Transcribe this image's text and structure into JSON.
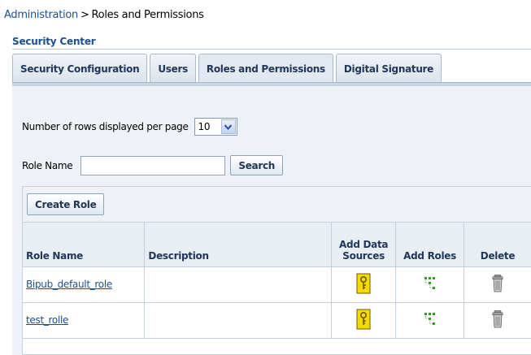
{
  "breadcrumb": {
    "parent": "Administration",
    "separator": ">",
    "current": "Roles and Permissions"
  },
  "section_title": "Security Center",
  "tabs": [
    {
      "label": "Security Configuration",
      "active": false
    },
    {
      "label": "Users",
      "active": false
    },
    {
      "label": "Roles and Permissions",
      "active": true
    },
    {
      "label": "Digital Signature",
      "active": false
    }
  ],
  "rows_per_page": {
    "label": "Number of rows displayed per page",
    "value": "10"
  },
  "search": {
    "label": "Role Name",
    "value": "",
    "button": "Search"
  },
  "create_button": "Create Role",
  "table": {
    "headers": {
      "role_name": "Role Name",
      "description": "Description",
      "add_data_sources_1": "Add Data",
      "add_data_sources_2": "Sources",
      "add_roles": "Add Roles",
      "delete": "Delete"
    },
    "rows": [
      {
        "role_name": "Bipub_default_role",
        "description": ""
      },
      {
        "role_name": "test_rolle",
        "description": ""
      }
    ]
  },
  "icons": {
    "data_source": "key-document-icon",
    "add_roles": "role-hierarchy-icon",
    "delete": "trash-can-icon"
  },
  "colors": {
    "link": "#1c4f8e",
    "panel": "#eef2f7",
    "key_icon": "#f5d90a",
    "roles_icon": "#2fa31f"
  }
}
